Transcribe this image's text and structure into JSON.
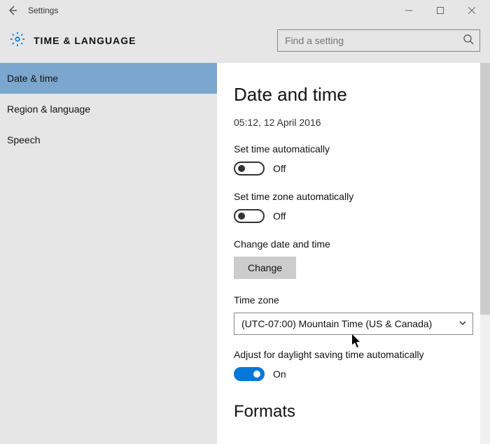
{
  "window": {
    "title": "Settings"
  },
  "header": {
    "section": "TIME & LANGUAGE",
    "search_placeholder": "Find a setting"
  },
  "sidebar": {
    "items": [
      {
        "label": "Date & time",
        "active": true
      },
      {
        "label": "Region & language",
        "active": false
      },
      {
        "label": "Speech",
        "active": false
      }
    ]
  },
  "main": {
    "heading": "Date and time",
    "current_datetime": "05:12, 12 April 2016",
    "set_time_auto_label": "Set time automatically",
    "set_time_auto_state": "Off",
    "set_tz_auto_label": "Set time zone automatically",
    "set_tz_auto_state": "Off",
    "change_dt_label": "Change date and time",
    "change_button": "Change",
    "tz_label": "Time zone",
    "tz_value": "(UTC-07:00) Mountain Time (US & Canada)",
    "dst_label": "Adjust for daylight saving time automatically",
    "dst_state": "On",
    "formats_heading": "Formats"
  }
}
